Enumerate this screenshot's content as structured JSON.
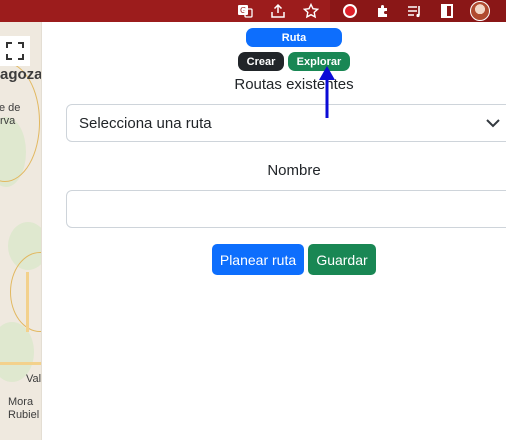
{
  "browser": {
    "icons": [
      "translate-icon",
      "share-icon",
      "star-icon",
      "extension-icon",
      "puzzle-icon",
      "reading-list-icon",
      "split-view-icon",
      "profile-avatar"
    ]
  },
  "map": {
    "labels": {
      "city_partial": "agoza",
      "town_partial_1": "e de",
      "town_partial_2": "rva",
      "val_partial": "Val",
      "mora_1": "Mora",
      "mora_2": "Rubiel"
    }
  },
  "badges": {
    "ruta": "Ruta",
    "crear": "Crear",
    "explorar": "Explorar"
  },
  "routes": {
    "title": "Routas existentes",
    "select_value": "Selecciona una ruta"
  },
  "name": {
    "label": "Nombre",
    "value": ""
  },
  "actions": {
    "plan": "Planear ruta",
    "save": "Guardar"
  },
  "colors": {
    "toolbar": "#9c1c1c",
    "primary": "#0d6efd",
    "success": "#198754",
    "dark": "#212529",
    "annotation_arrow": "#0b0bd6"
  }
}
